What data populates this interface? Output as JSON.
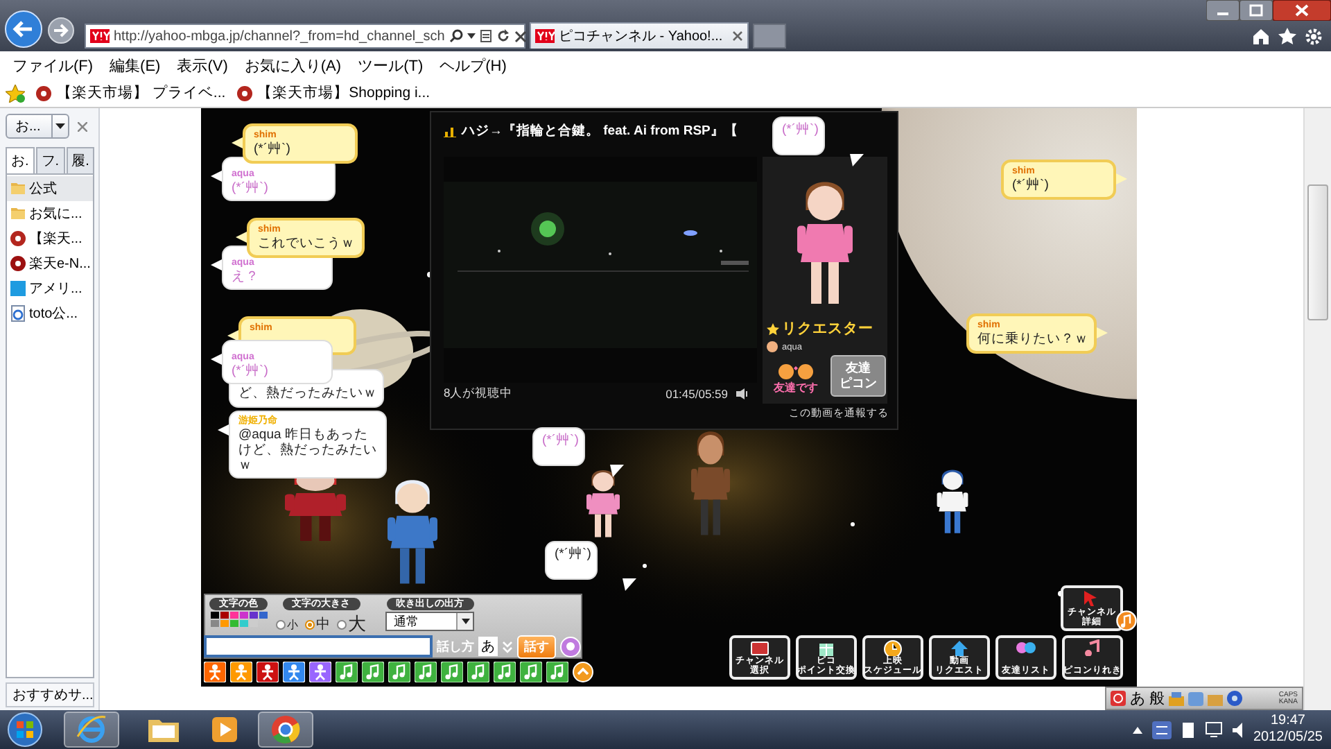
{
  "browser": {
    "address": "http://yahoo-mbga.jp/channel?_from=hd_channel_sch",
    "tab_title": "ピコチャンネル - Yahoo!...",
    "menu": [
      "ファイル(F)",
      "編集(E)",
      "表示(V)",
      "お気に入り(A)",
      "ツール(T)",
      "ヘルプ(H)"
    ],
    "favorites": [
      "【楽天市場】 プライベ...",
      "【楽天市場】Shopping i..."
    ]
  },
  "favorites_pane": {
    "dropdown": "お...",
    "tabs": [
      {
        "label": "お.",
        "selected": true
      },
      {
        "label": "フ.",
        "selected": false
      },
      {
        "label": "履.",
        "selected": false
      }
    ],
    "items": [
      {
        "label": "公式",
        "selected": true
      },
      {
        "label": "お気に...",
        "selected": false
      },
      {
        "label": "【楽天...",
        "selected": false
      },
      {
        "label": "楽天e-N...",
        "selected": false
      },
      {
        "label": "アメリ...",
        "selected": false
      },
      {
        "label": "toto公...",
        "selected": false
      }
    ],
    "bottom_button": "おすすめサ..."
  },
  "stage": {
    "bubbles": [
      {
        "kind": "highlight",
        "name": "shim",
        "color": "#e07000",
        "text": "(*´艸`)"
      },
      {
        "kind": "soft",
        "name": "aqua",
        "color": "#d070d0",
        "text": "(*´艸`)"
      },
      {
        "kind": "highlight",
        "name": "shim",
        "color": "#e07000",
        "text": "これでいこうｗ"
      },
      {
        "kind": "soft",
        "name": "aqua",
        "color": "#d070d0",
        "text": "え？"
      },
      {
        "kind": "highlight",
        "name": "shim",
        "color": "#e07000"
      },
      {
        "kind": "soft",
        "name": "aqua",
        "color": "#d070d0",
        "text": "(*´艸`)"
      },
      {
        "kind": "plain",
        "text": "ど、熱だったみたいｗ"
      },
      {
        "kind": "plain",
        "name": "游姫乃命",
        "color": "#f0b000",
        "text": "@aqua 昨日もあったけど、熱だったみたいｗ"
      },
      {
        "kind": "highlight",
        "name": "shim",
        "color": "#e07000",
        "text": "(*´艸`)"
      },
      {
        "kind": "highlight",
        "name": "shim",
        "color": "#e07000",
        "text": "何に乗りたい？ｗ"
      },
      {
        "kind": "soft",
        "text": "(*´艸`)"
      },
      {
        "kind": "soft",
        "text": "(*´艸`)"
      },
      {
        "kind": "plain",
        "text": "(*´艸`)"
      }
    ],
    "video": {
      "title": "ハジ→『指輪と合鍵。 feat. Ai from RSP』【",
      "viewers": "8人が視聴中",
      "time": "01:45/05:59",
      "requester_label": "リクエスター",
      "requester_name": "aqua",
      "friend_badge": "友達です",
      "friend_button": [
        "友達",
        "ピコン"
      ],
      "report_link": "この動画を通報する"
    },
    "controls": {
      "color_label": "文字の色",
      "size_label": "文字の大きさ",
      "style_label": "吹き出しの出方",
      "colors": [
        {
          "color": "#000000"
        },
        {
          "color": "#aa0000"
        },
        {
          "color": "#ff3399"
        },
        {
          "color": "#cc33cc"
        },
        {
          "color": "#6633cc"
        },
        {
          "color": "#3366cc"
        },
        {
          "color": "#888888"
        },
        {
          "color": "#ff9900"
        },
        {
          "color": "#33bb33"
        },
        {
          "color": "#33cccc"
        },
        {
          "color": "#cccccc"
        }
      ],
      "sizes": [
        {
          "label": "小",
          "selected": false
        },
        {
          "label": "中",
          "selected": true
        },
        {
          "label": "大",
          "selected": false
        }
      ],
      "bubble_style": "通常",
      "speech_label": "話し方",
      "speech_mode": "あ",
      "speak_button": "話す",
      "actions": [
        {
          "kind": "figure",
          "color": "#ff6600"
        },
        {
          "kind": "figure",
          "color": "#ff9900"
        },
        {
          "kind": "figure",
          "color": "#cc1111"
        },
        {
          "kind": "figure",
          "color": "#3388ee"
        },
        {
          "kind": "figure",
          "color": "#9966ff"
        },
        {
          "kind": "note"
        },
        {
          "kind": "note"
        },
        {
          "kind": "note"
        },
        {
          "kind": "note"
        },
        {
          "kind": "note"
        },
        {
          "kind": "note"
        },
        {
          "kind": "note"
        },
        {
          "kind": "note"
        },
        {
          "kind": "note"
        }
      ]
    },
    "menu_buttons": [
      [
        "チャンネル",
        "選択"
      ],
      [
        "ピコ",
        "ポイント交換"
      ],
      [
        "上映",
        "スケジュール"
      ],
      [
        "動画",
        "リクエスト"
      ],
      [
        "友達リスト"
      ],
      [
        "ピコンりれき"
      ]
    ],
    "channel_detail": [
      "チャンネル",
      "詳細"
    ]
  },
  "ime_bar": {
    "mode": "あ",
    "dictionary": "般",
    "caps": "CAPS",
    "kana": "KANA"
  },
  "taskbar": {
    "time": "19:47",
    "date": "2012/05/25"
  }
}
